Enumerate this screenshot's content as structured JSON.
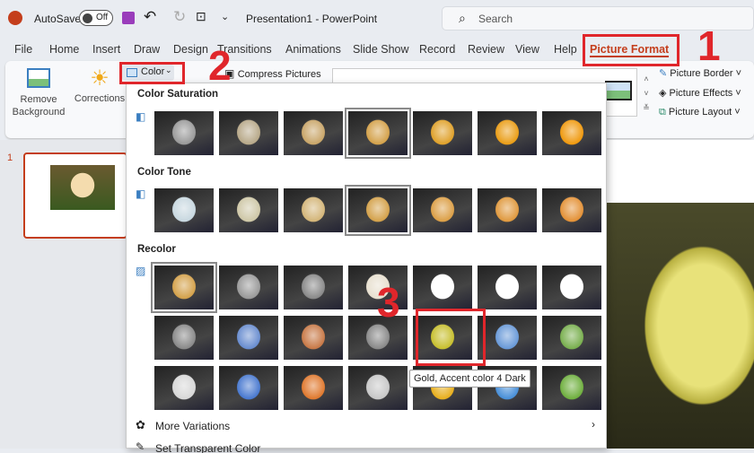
{
  "titlebar": {
    "autosave": "AutoSave",
    "toggle": "Off",
    "title": "Presentation1 - PowerPoint",
    "search_placeholder": "Search"
  },
  "tabs": [
    "File",
    "Home",
    "Insert",
    "Draw",
    "Design",
    "Transitions",
    "Animations",
    "Slide Show",
    "Record",
    "Review",
    "View",
    "Help",
    "Picture Format"
  ],
  "ribbon": {
    "remove_background": "Remove Background",
    "corrections": "Corrections",
    "color": "Color",
    "compress": "Compress Pictures",
    "picture_border": "Picture Border",
    "picture_effects": "Picture Effects",
    "picture_layout": "Picture Layout"
  },
  "panel": {
    "color_saturation": "Color Saturation",
    "color_tone": "Color Tone",
    "recolor": "Recolor",
    "saturation_tints": [
      "#9a9a9a",
      "#b8a98a",
      "#c9a66a",
      "#d4a24c",
      "#e0a22c",
      "#ea9e18",
      "#f09a10"
    ],
    "tone_tints": [
      "#c8d8e0",
      "#cfc8a8",
      "#d4b67a",
      "#d4a24c",
      "#dca048",
      "#e09a40",
      "#e49238"
    ],
    "recolor_rows": [
      [
        "#d4a24c",
        "#9a9a9a",
        "#8a8a8a",
        "#e8e0d0",
        "#ffffff",
        "#ffffff",
        "#ffffff"
      ],
      [
        "#8a8a8a",
        "#6a8ed0",
        "#c87a48",
        "#8a8a8a",
        "#c8c030",
        "#6a9ad8",
        "#7ab050"
      ],
      [
        "#d8d8d8",
        "#4a7ad0",
        "#e07a30",
        "#c8c8c8",
        "#e8b020",
        "#4a90d8",
        "#70b040"
      ]
    ],
    "selected": {
      "saturation": 3,
      "tone": 3,
      "recolor_row": 0,
      "recolor_col": 0
    },
    "hover": {
      "row": 1,
      "col": 4
    },
    "tooltip": "Gold, Accent color 4 Dark",
    "more_variations": "More Variations",
    "set_transparent": "Set Transparent Color"
  },
  "slide": {
    "number": "1"
  },
  "annotations": {
    "one": "1",
    "two": "2",
    "three": "3",
    "color": "#e0262b"
  },
  "accent": "#c43e1c"
}
